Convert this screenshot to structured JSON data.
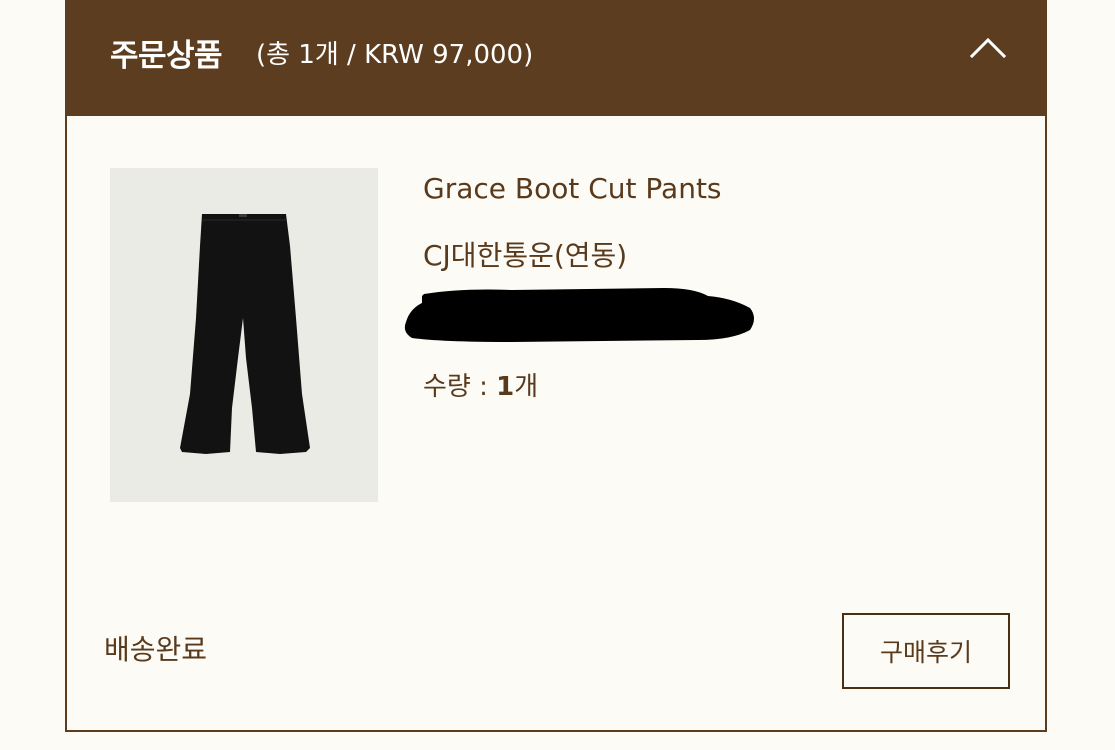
{
  "order": {
    "header": {
      "title": "주문상품",
      "summary": "(총 1개 / KRW 97,000)",
      "collapse_icon": "chevron-up-icon"
    },
    "item": {
      "image_alt": "black boot cut pants product photo",
      "name": "Grace Boot Cut Pants",
      "carrier": "CJ대한통운(연동)",
      "quantity_label": "수량 : ",
      "quantity_value": "1",
      "quantity_unit": "개"
    },
    "status": "배송완료",
    "review_button": "구매후기"
  },
  "colors": {
    "header_bg": "#5c3d1f",
    "page_bg": "#fcfbf5",
    "text_brown": "#5a3a1c",
    "thumb_bg": "#ebebe6"
  }
}
